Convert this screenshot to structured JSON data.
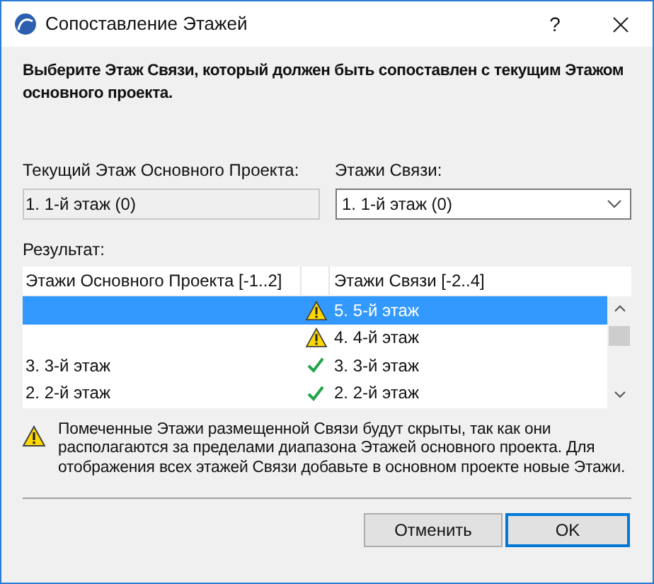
{
  "window": {
    "title": "Сопоставление Этажей",
    "help": "?"
  },
  "instruction": "Выберите Этаж Связи, который должен быть сопоставлен с текущим Этажом основного проекта.",
  "current_story": {
    "label": "Текущий Этаж Основного Проекта:",
    "value": "1. 1-й этаж (0)"
  },
  "link_stories": {
    "label": "Этажи Связи:",
    "value": "1. 1-й этаж (0)"
  },
  "result": {
    "label": "Результат:",
    "columns": [
      "Этажи Основного Проекта [-1..2]",
      "Этажи Связи [-2..4]"
    ],
    "rows": [
      {
        "host": "",
        "kind": "warning",
        "link": "5. 5-й этаж",
        "selected": true
      },
      {
        "host": "",
        "kind": "warning",
        "link": "4. 4-й этаж",
        "selected": false
      },
      {
        "host": "3. 3-й этаж",
        "kind": "ok",
        "link": "3. 3-й этаж",
        "selected": false
      },
      {
        "host": "2. 2-й этаж",
        "kind": "ok",
        "link": "2. 2-й этаж",
        "selected": false
      }
    ]
  },
  "warning": "Помеченные Этажи размещенной Связи будут скрыты, так как они располагаются за пределами диапазона Этажей основного проекта. Для отображения всех этажей Связи добавьте в основном проекте новые Этажи.",
  "buttons": [
    {
      "label": "Отменить",
      "default": false
    },
    {
      "label": "OK",
      "default": true
    }
  ]
}
